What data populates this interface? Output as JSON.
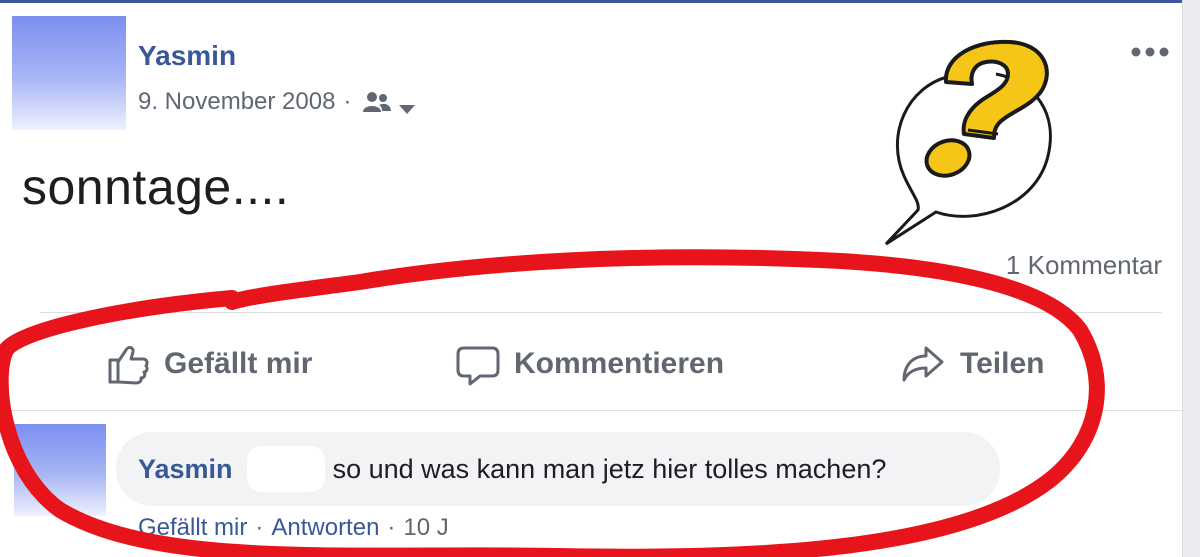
{
  "post": {
    "author": "Yasmin",
    "date": "9. November 2008",
    "meta_separator": "·",
    "audience_icon": "friends-icon",
    "text": "sonntage....",
    "comment_count": "1 Kommentar",
    "sticker": "question-mark-speech-bubble"
  },
  "actions": {
    "like_label": "Gefällt mir",
    "comment_label": "Kommentieren",
    "share_label": "Teilen"
  },
  "comment": {
    "author": "Yasmin",
    "text": "so und was kann man jetz hier tolles machen?",
    "like_label": "Gefällt mir",
    "separator": "·",
    "reply_label": "Antworten",
    "time": "10 J"
  },
  "colors": {
    "link_blue": "#385898",
    "secondary_text": "#606770",
    "annotation_red": "#e8141b",
    "sticker_yellow": "#f5c518"
  }
}
